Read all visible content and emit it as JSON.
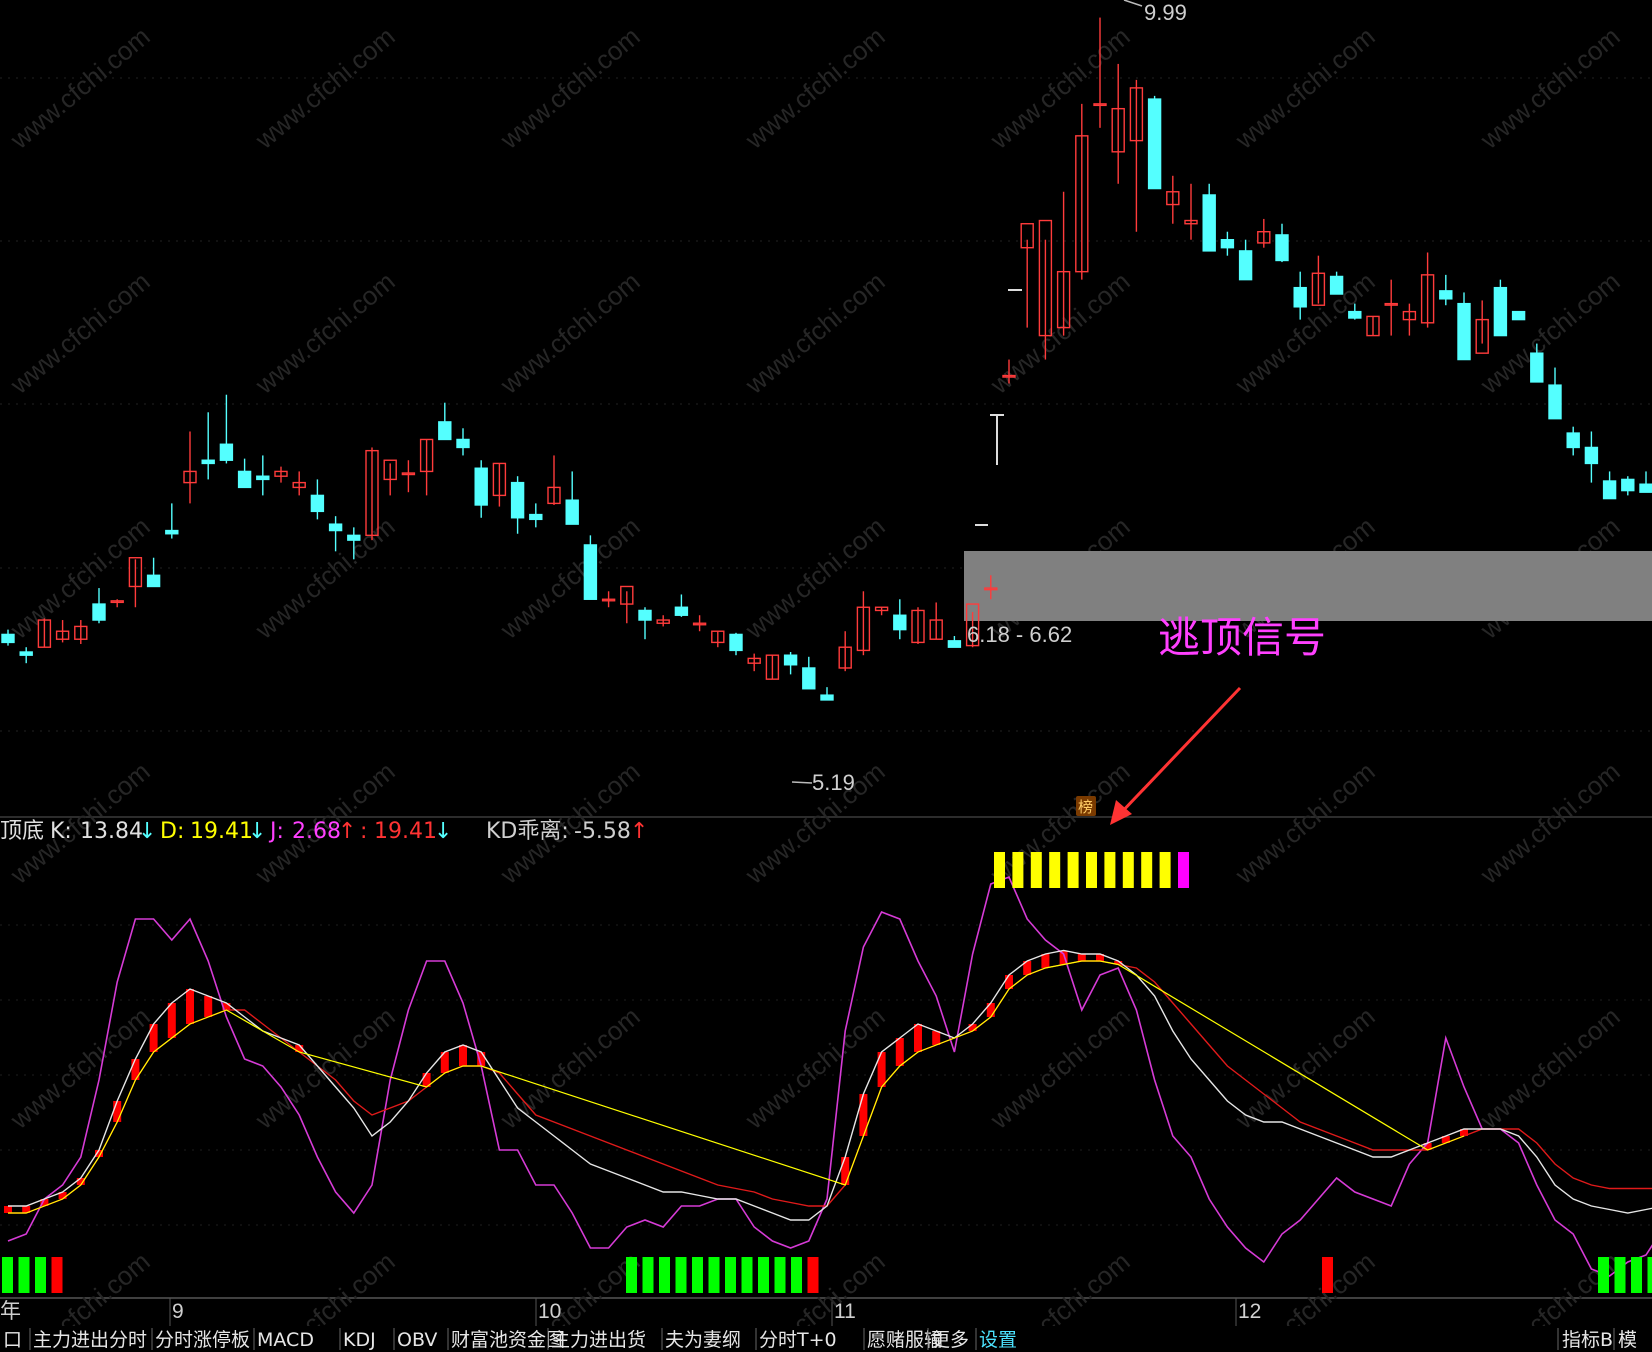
{
  "colors": {
    "background": "#000000",
    "up": "#ff3b3b",
    "down": "#54ffff",
    "k_line": "#e0e0e0",
    "d_line": "#ff2020",
    "j_line": "#d63bd6",
    "yellow": "#ffff00",
    "magenta": "#ff00ff",
    "green": "#00ff00",
    "red_bar": "#ff0000",
    "zone_fill": "#808080",
    "toolbar_active": "#4de3ff"
  },
  "price_panel": {
    "high_label": "9.99",
    "low_label": "5.19",
    "zone_label": "6.18 - 6.62",
    "signal_label": "逃顶信号",
    "badge_label": "榜"
  },
  "indicator_header": {
    "name": "顶底",
    "k_label": "K:",
    "k_value": "13.84",
    "d_label": "D:",
    "d_value": "19.41",
    "j_label": "J:",
    "j_value": "2.68",
    "x_label": ":",
    "x_value": "19.41",
    "kd_label": "KD乖离:",
    "kd_value": "-5.58"
  },
  "date_axis": {
    "labels": [
      "年",
      "9",
      "10",
      "11",
      "12"
    ]
  },
  "toolbar": {
    "tabs": [
      "口",
      "主力进出分时",
      "分时涨停板",
      "MACD",
      "KDJ",
      "OBV",
      "财富池资金图",
      "主力进出货",
      "夫为妻纲",
      "分时T+0",
      "愿赌服输",
      "更多",
      "设置"
    ],
    "active_tab": "设置",
    "right_tabs": [
      "指标B",
      "模"
    ]
  },
  "watermark_text": "www.cfchi.com",
  "chart_data": [
    {
      "type": "candlestick",
      "title": "",
      "x": [
        "c1",
        "c2",
        "c3",
        "c4",
        "c5",
        "c6",
        "c7",
        "c8",
        "c9",
        "c10",
        "c11",
        "c12",
        "c13",
        "c14",
        "c15",
        "c16",
        "c17",
        "c18",
        "c19",
        "c20",
        "c21",
        "c22",
        "c23",
        "c24",
        "c25",
        "c26",
        "c27",
        "c28",
        "c29",
        "c30",
        "c31",
        "c32",
        "c33",
        "c34",
        "c35",
        "c36",
        "c37",
        "c38",
        "c39",
        "c40",
        "c41",
        "c42",
        "c43",
        "c44",
        "c45",
        "c46",
        "c47",
        "c48",
        "c49",
        "c50",
        "c51",
        "c52",
        "c53",
        "c54",
        "c55",
        "c56",
        "c57",
        "c58",
        "c59",
        "c60",
        "c61",
        "c62",
        "c63",
        "c64",
        "c65",
        "c66",
        "c67",
        "c68",
        "c69",
        "c70",
        "c71",
        "c72",
        "c73",
        "c74",
        "c75",
        "c76",
        "c77",
        "c78",
        "c79",
        "c80",
        "c81",
        "c82",
        "c83",
        "c84",
        "c85",
        "c86",
        "c87",
        "c88",
        "c89",
        "c90",
        "c91",
        "c92"
      ],
      "ohlc": [
        [
          6.13,
          6.16,
          6.06,
          6.08
        ],
        [
          6.02,
          6.05,
          5.95,
          6.0
        ],
        [
          6.05,
          6.23,
          6.05,
          6.22
        ],
        [
          6.1,
          6.22,
          6.08,
          6.15
        ],
        [
          6.1,
          6.22,
          6.07,
          6.18
        ],
        [
          6.32,
          6.42,
          6.2,
          6.22
        ],
        [
          6.34,
          6.35,
          6.3,
          6.34
        ],
        [
          6.43,
          6.6,
          6.3,
          6.61
        ],
        [
          6.5,
          6.61,
          6.45,
          6.43
        ],
        [
          6.78,
          6.95,
          6.73,
          6.76
        ],
        [
          7.08,
          7.4,
          6.95,
          7.15
        ],
        [
          7.22,
          7.52,
          7.1,
          7.2
        ],
        [
          7.32,
          7.63,
          7.2,
          7.22
        ],
        [
          7.15,
          7.23,
          7.05,
          7.05
        ],
        [
          7.12,
          7.25,
          7.0,
          7.1
        ],
        [
          7.12,
          7.18,
          7.08,
          7.15
        ],
        [
          7.05,
          7.15,
          7.0,
          7.08
        ],
        [
          7.0,
          7.1,
          6.85,
          6.9
        ],
        [
          6.82,
          6.87,
          6.65,
          6.78
        ],
        [
          6.75,
          6.8,
          6.6,
          6.72
        ],
        [
          6.75,
          7.3,
          6.72,
          7.28
        ],
        [
          7.1,
          7.2,
          7.0,
          7.22
        ],
        [
          7.14,
          7.22,
          7.02,
          7.14
        ],
        [
          7.15,
          7.35,
          7.0,
          7.35
        ],
        [
          7.46,
          7.58,
          7.36,
          7.35
        ],
        [
          7.35,
          7.42,
          7.25,
          7.3
        ],
        [
          7.17,
          7.22,
          6.86,
          6.94
        ],
        [
          7.0,
          7.2,
          6.93,
          7.2
        ],
        [
          7.08,
          7.12,
          6.76,
          6.86
        ],
        [
          6.88,
          6.95,
          6.8,
          6.85
        ],
        [
          6.95,
          7.25,
          6.94,
          7.05
        ],
        [
          6.97,
          7.15,
          6.9,
          6.82
        ],
        [
          6.69,
          6.75,
          6.6,
          6.35
        ],
        [
          6.35,
          6.4,
          6.3,
          6.35
        ],
        [
          6.32,
          6.4,
          6.2,
          6.43
        ],
        [
          6.28,
          6.3,
          6.1,
          6.22
        ],
        [
          6.2,
          6.25,
          6.18,
          6.22
        ],
        [
          6.3,
          6.38,
          6.24,
          6.25
        ],
        [
          6.2,
          6.25,
          6.15,
          6.2
        ],
        [
          6.08,
          6.15,
          6.05,
          6.15
        ],
        [
          6.13,
          6.14,
          6.0,
          6.03
        ],
        [
          5.95,
          6.01,
          5.9,
          5.98
        ],
        [
          5.85,
          6.0,
          5.85,
          6.0
        ],
        [
          6.0,
          6.02,
          5.88,
          5.94
        ],
        [
          5.92,
          5.99,
          5.83,
          5.79
        ],
        [
          5.75,
          5.8,
          5.72,
          5.72
        ],
        [
          5.92,
          6.15,
          5.9,
          6.05
        ],
        [
          6.03,
          6.4,
          6.0,
          6.3
        ],
        [
          6.28,
          6.3,
          6.25,
          6.3
        ],
        [
          6.25,
          6.35,
          6.1,
          6.16
        ],
        [
          6.08,
          6.3,
          6.07,
          6.28
        ],
        [
          6.1,
          6.33,
          6.1,
          6.22
        ],
        [
          6.09,
          6.12,
          6.08,
          6.05
        ],
        [
          6.06,
          6.27,
          6.05,
          6.32
        ],
        [
          6.41,
          6.5,
          6.35,
          6.42
        ],
        [
          7.75,
          7.85,
          7.7,
          7.75
        ],
        [
          8.55,
          8.6,
          8.05,
          8.7
        ],
        [
          8.0,
          8.6,
          7.85,
          8.72
        ],
        [
          8.05,
          8.9,
          8.0,
          8.4
        ],
        [
          8.4,
          9.45,
          8.35,
          9.25
        ],
        [
          9.45,
          9.99,
          9.3,
          9.45
        ],
        [
          9.15,
          9.7,
          8.95,
          9.42
        ],
        [
          9.22,
          9.6,
          8.65,
          9.55
        ],
        [
          9.48,
          9.5,
          8.95,
          8.92
        ],
        [
          8.82,
          9.0,
          8.7,
          8.9
        ],
        [
          8.7,
          8.95,
          8.6,
          8.72
        ],
        [
          8.88,
          8.95,
          8.6,
          8.53
        ],
        [
          8.6,
          8.65,
          8.5,
          8.55
        ],
        [
          8.53,
          8.6,
          8.35,
          8.35
        ],
        [
          8.58,
          8.73,
          8.55,
          8.65
        ],
        [
          8.63,
          8.7,
          8.46,
          8.47
        ],
        [
          8.3,
          8.4,
          8.1,
          8.18
        ],
        [
          8.19,
          8.5,
          8.2,
          8.39
        ],
        [
          8.37,
          8.4,
          8.32,
          8.26
        ],
        [
          8.15,
          8.2,
          8.1,
          8.11
        ],
        [
          8.0,
          8.12,
          8.0,
          8.12
        ],
        [
          8.2,
          8.35,
          8.0,
          8.2
        ],
        [
          8.1,
          8.2,
          8.0,
          8.15
        ],
        [
          8.08,
          8.52,
          8.05,
          8.38
        ],
        [
          8.28,
          8.38,
          8.19,
          8.23
        ],
        [
          8.2,
          8.27,
          7.98,
          7.85
        ],
        [
          7.89,
          8.22,
          7.95,
          8.1
        ],
        [
          8.3,
          8.35,
          8.0,
          8.0
        ],
        [
          8.15,
          8.13,
          8.1,
          8.1
        ],
        [
          7.89,
          7.95,
          7.85,
          7.71
        ],
        [
          7.69,
          7.8,
          7.55,
          7.48
        ],
        [
          7.39,
          7.43,
          7.25,
          7.3
        ],
        [
          7.3,
          7.4,
          7.08,
          7.2
        ],
        [
          7.09,
          7.15,
          6.98,
          6.98
        ],
        [
          7.1,
          7.12,
          7.0,
          7.03
        ],
        [
          7.07,
          7.15,
          7.05,
          7.02
        ],
        [
          7.03,
          7.1,
          6.98,
          7.06
        ]
      ],
      "ylim": [
        5.0,
        10.1
      ],
      "annotations": [
        {
          "label": "9.99",
          "value": 9.99
        },
        {
          "label": "5.19",
          "value": 5.19
        },
        {
          "label": "6.18 - 6.62",
          "range": [
            6.18,
            6.62
          ]
        }
      ]
    },
    {
      "type": "line",
      "title": "",
      "series": [
        {
          "name": "K",
          "values": [
            14,
            14,
            16,
            18,
            22,
            30,
            44,
            56,
            66,
            72,
            76,
            74,
            72,
            68,
            64,
            62,
            60,
            54,
            48,
            42,
            34,
            38,
            44,
            52,
            58,
            60,
            58,
            50,
            42,
            38,
            34,
            30,
            26,
            24,
            22,
            20,
            18,
            18,
            17,
            16,
            16,
            14,
            12,
            10,
            10,
            14,
            28,
            46,
            58,
            62,
            66,
            64,
            62,
            66,
            72,
            80,
            84,
            86,
            87,
            86,
            86,
            84,
            80,
            74,
            64,
            56,
            50,
            44,
            40,
            38,
            38,
            36,
            34,
            32,
            30,
            28,
            28,
            30,
            32,
            34,
            36,
            36,
            36,
            34,
            28,
            20,
            16,
            14,
            13,
            12,
            13,
            14
          ]
        },
        {
          "name": "D",
          "values": [
            12,
            12,
            14,
            16,
            20,
            28,
            38,
            50,
            58,
            62,
            66,
            68,
            70,
            70,
            66,
            62,
            58,
            54,
            50,
            44,
            40,
            42,
            44,
            48,
            52,
            54,
            54,
            52,
            46,
            40,
            38,
            36,
            34,
            32,
            30,
            28,
            26,
            24,
            22,
            20,
            19,
            18,
            16,
            15,
            14,
            14,
            20,
            34,
            48,
            54,
            58,
            60,
            62,
            64,
            68,
            76,
            80,
            82,
            83,
            84,
            84,
            83,
            82,
            78,
            72,
            66,
            60,
            54,
            50,
            46,
            42,
            38,
            36,
            34,
            32,
            30,
            30,
            30,
            30,
            32,
            34,
            36,
            36,
            36,
            32,
            26,
            22,
            20,
            19,
            19,
            19,
            19
          ]
        },
        {
          "name": "J",
          "values": [
            4,
            6,
            16,
            20,
            28,
            50,
            78,
            96,
            96,
            90,
            96,
            84,
            68,
            56,
            54,
            48,
            40,
            28,
            18,
            12,
            20,
            50,
            70,
            84,
            84,
            72,
            54,
            30,
            30,
            20,
            20,
            12,
            2,
            2,
            8,
            10,
            8,
            14,
            14,
            16,
            16,
            8,
            4,
            2,
            4,
            16,
            64,
            88,
            98,
            96,
            84,
            74,
            58,
            86,
            106,
            108,
            96,
            90,
            86,
            70,
            80,
            82,
            70,
            50,
            34,
            28,
            16,
            8,
            2,
            -2,
            6,
            10,
            16,
            22,
            18,
            16,
            14,
            26,
            32,
            62,
            48,
            36,
            36,
            32,
            20,
            10,
            6,
            -4,
            -6,
            -2,
            0,
            8
          ]
        }
      ],
      "signal_rows": {
        "top": [
          "yellow",
          "yellow",
          "yellow",
          "yellow",
          "yellow",
          "yellow",
          "yellow",
          "yellow",
          "yellow",
          "yellow",
          "magenta"
        ],
        "bottom_groups": [
          [
            "green",
            "green",
            "green",
            "red"
          ],
          [
            "green",
            "green",
            "green",
            "green",
            "green",
            "green",
            "green",
            "green",
            "green",
            "green",
            "green",
            "red"
          ],
          [
            "red"
          ],
          [
            "green",
            "green",
            "green",
            "green"
          ]
        ]
      }
    }
  ]
}
